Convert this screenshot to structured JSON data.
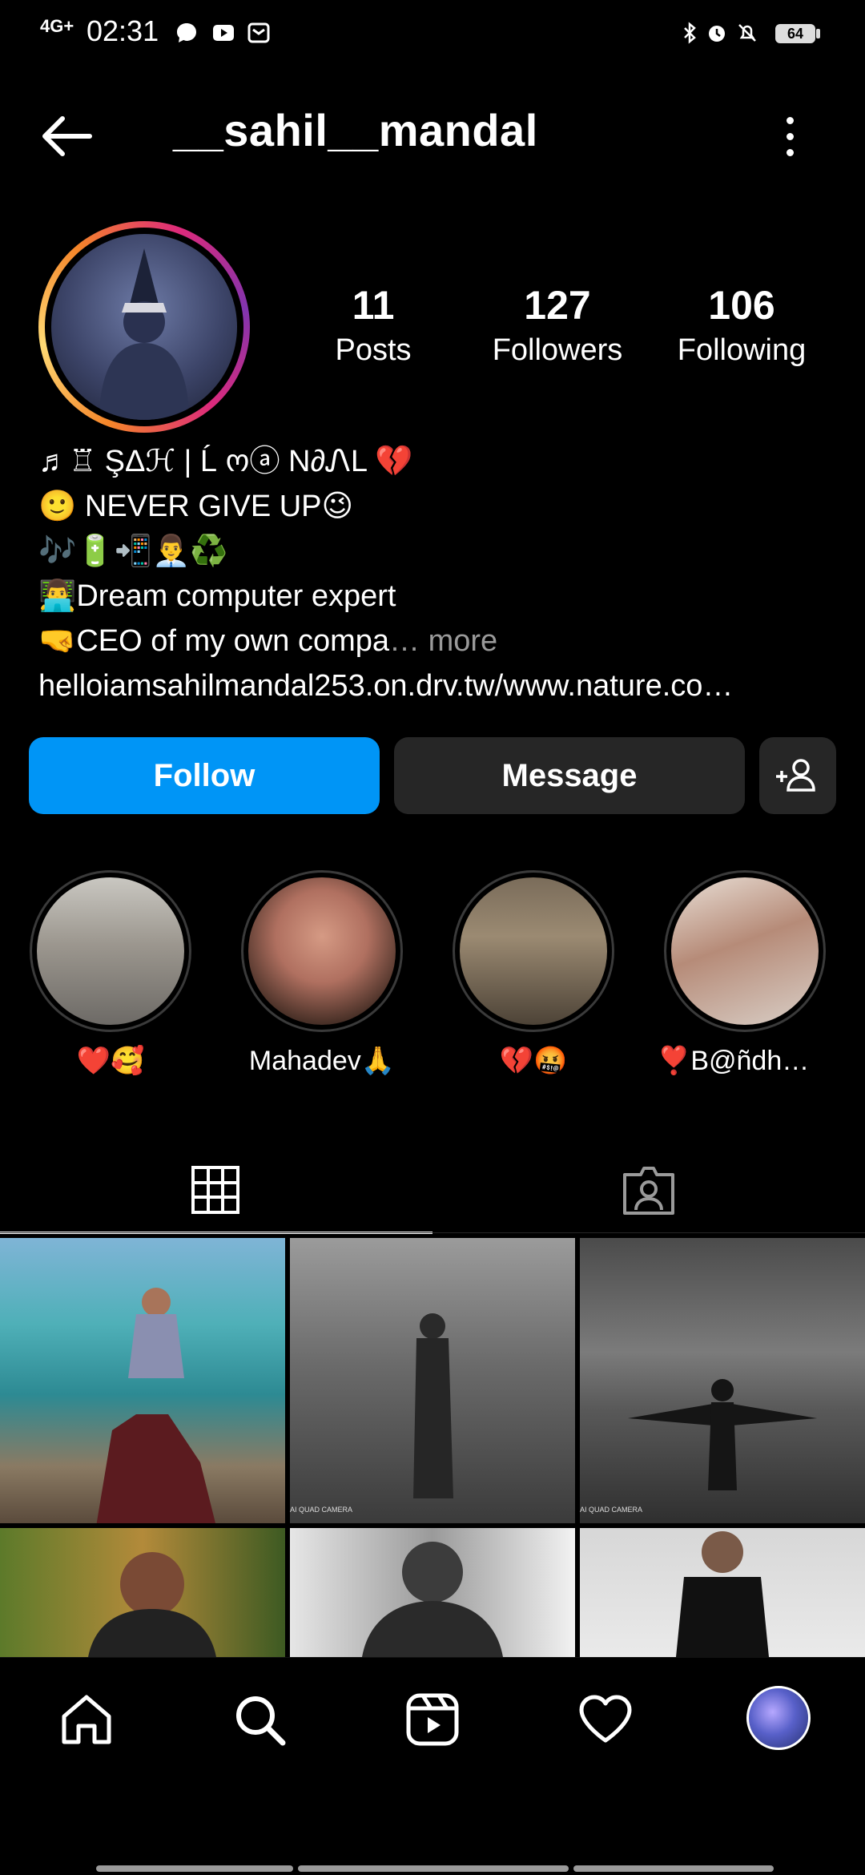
{
  "status_bar": {
    "network": "4G+",
    "time": "02:31",
    "battery": "64"
  },
  "header": {
    "username": "__sahil__mandal"
  },
  "stats": {
    "posts": {
      "value": "11",
      "label": "Posts"
    },
    "followers": {
      "value": "127",
      "label": "Followers"
    },
    "following": {
      "value": "106",
      "label": "Following"
    }
  },
  "bio": {
    "line1": "♬♖ ŞΔℋ | Ĺ ოⓐ N∂ᏁL 💔",
    "line2": "🙂 NEVER GIVE UP😉",
    "line3": "🎶🔋📲👨‍💼♻️",
    "line4": "👨‍💻Dream computer expert",
    "line5": "🤜CEO of my own compa",
    "more": "… more",
    "link": "helloiamsahilmandal253.on.drv.tw/www.nature.co…"
  },
  "actions": {
    "follow": "Follow",
    "message": "Message"
  },
  "highlights": [
    {
      "label": "❤️🥰"
    },
    {
      "label": "Mahadev🙏"
    },
    {
      "label": "💔🤬"
    },
    {
      "label": "❣️B@ñdh@ñ…"
    }
  ],
  "photo_watermarks": {
    "cell2": "AI QUAD CAMERA",
    "cell3": "AI QUAD CAMERA"
  },
  "colors": {
    "accent": "#0095f6",
    "background": "#000000",
    "button_dark": "#262626"
  }
}
